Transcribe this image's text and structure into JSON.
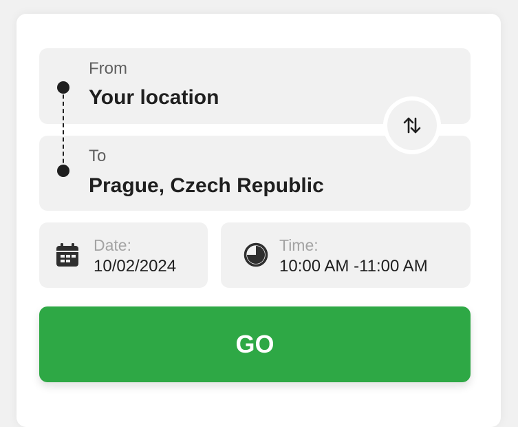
{
  "from": {
    "label": "From",
    "value": "Your location"
  },
  "to": {
    "label": "To",
    "value": "Prague, Czech Republic"
  },
  "swap": {
    "icon": "swap-vertical-icon"
  },
  "date": {
    "label": "Date:",
    "value": "10/02/2024",
    "icon": "calendar-icon"
  },
  "time": {
    "label": "Time:",
    "value": "10:00 AM -11:00 AM",
    "icon": "clock-icon"
  },
  "go_button": {
    "label": "GO"
  },
  "colors": {
    "accent": "#2ea845",
    "field_background": "#f1f1f1",
    "text": "#1f1f1f",
    "muted_label": "#a3a3a3"
  }
}
